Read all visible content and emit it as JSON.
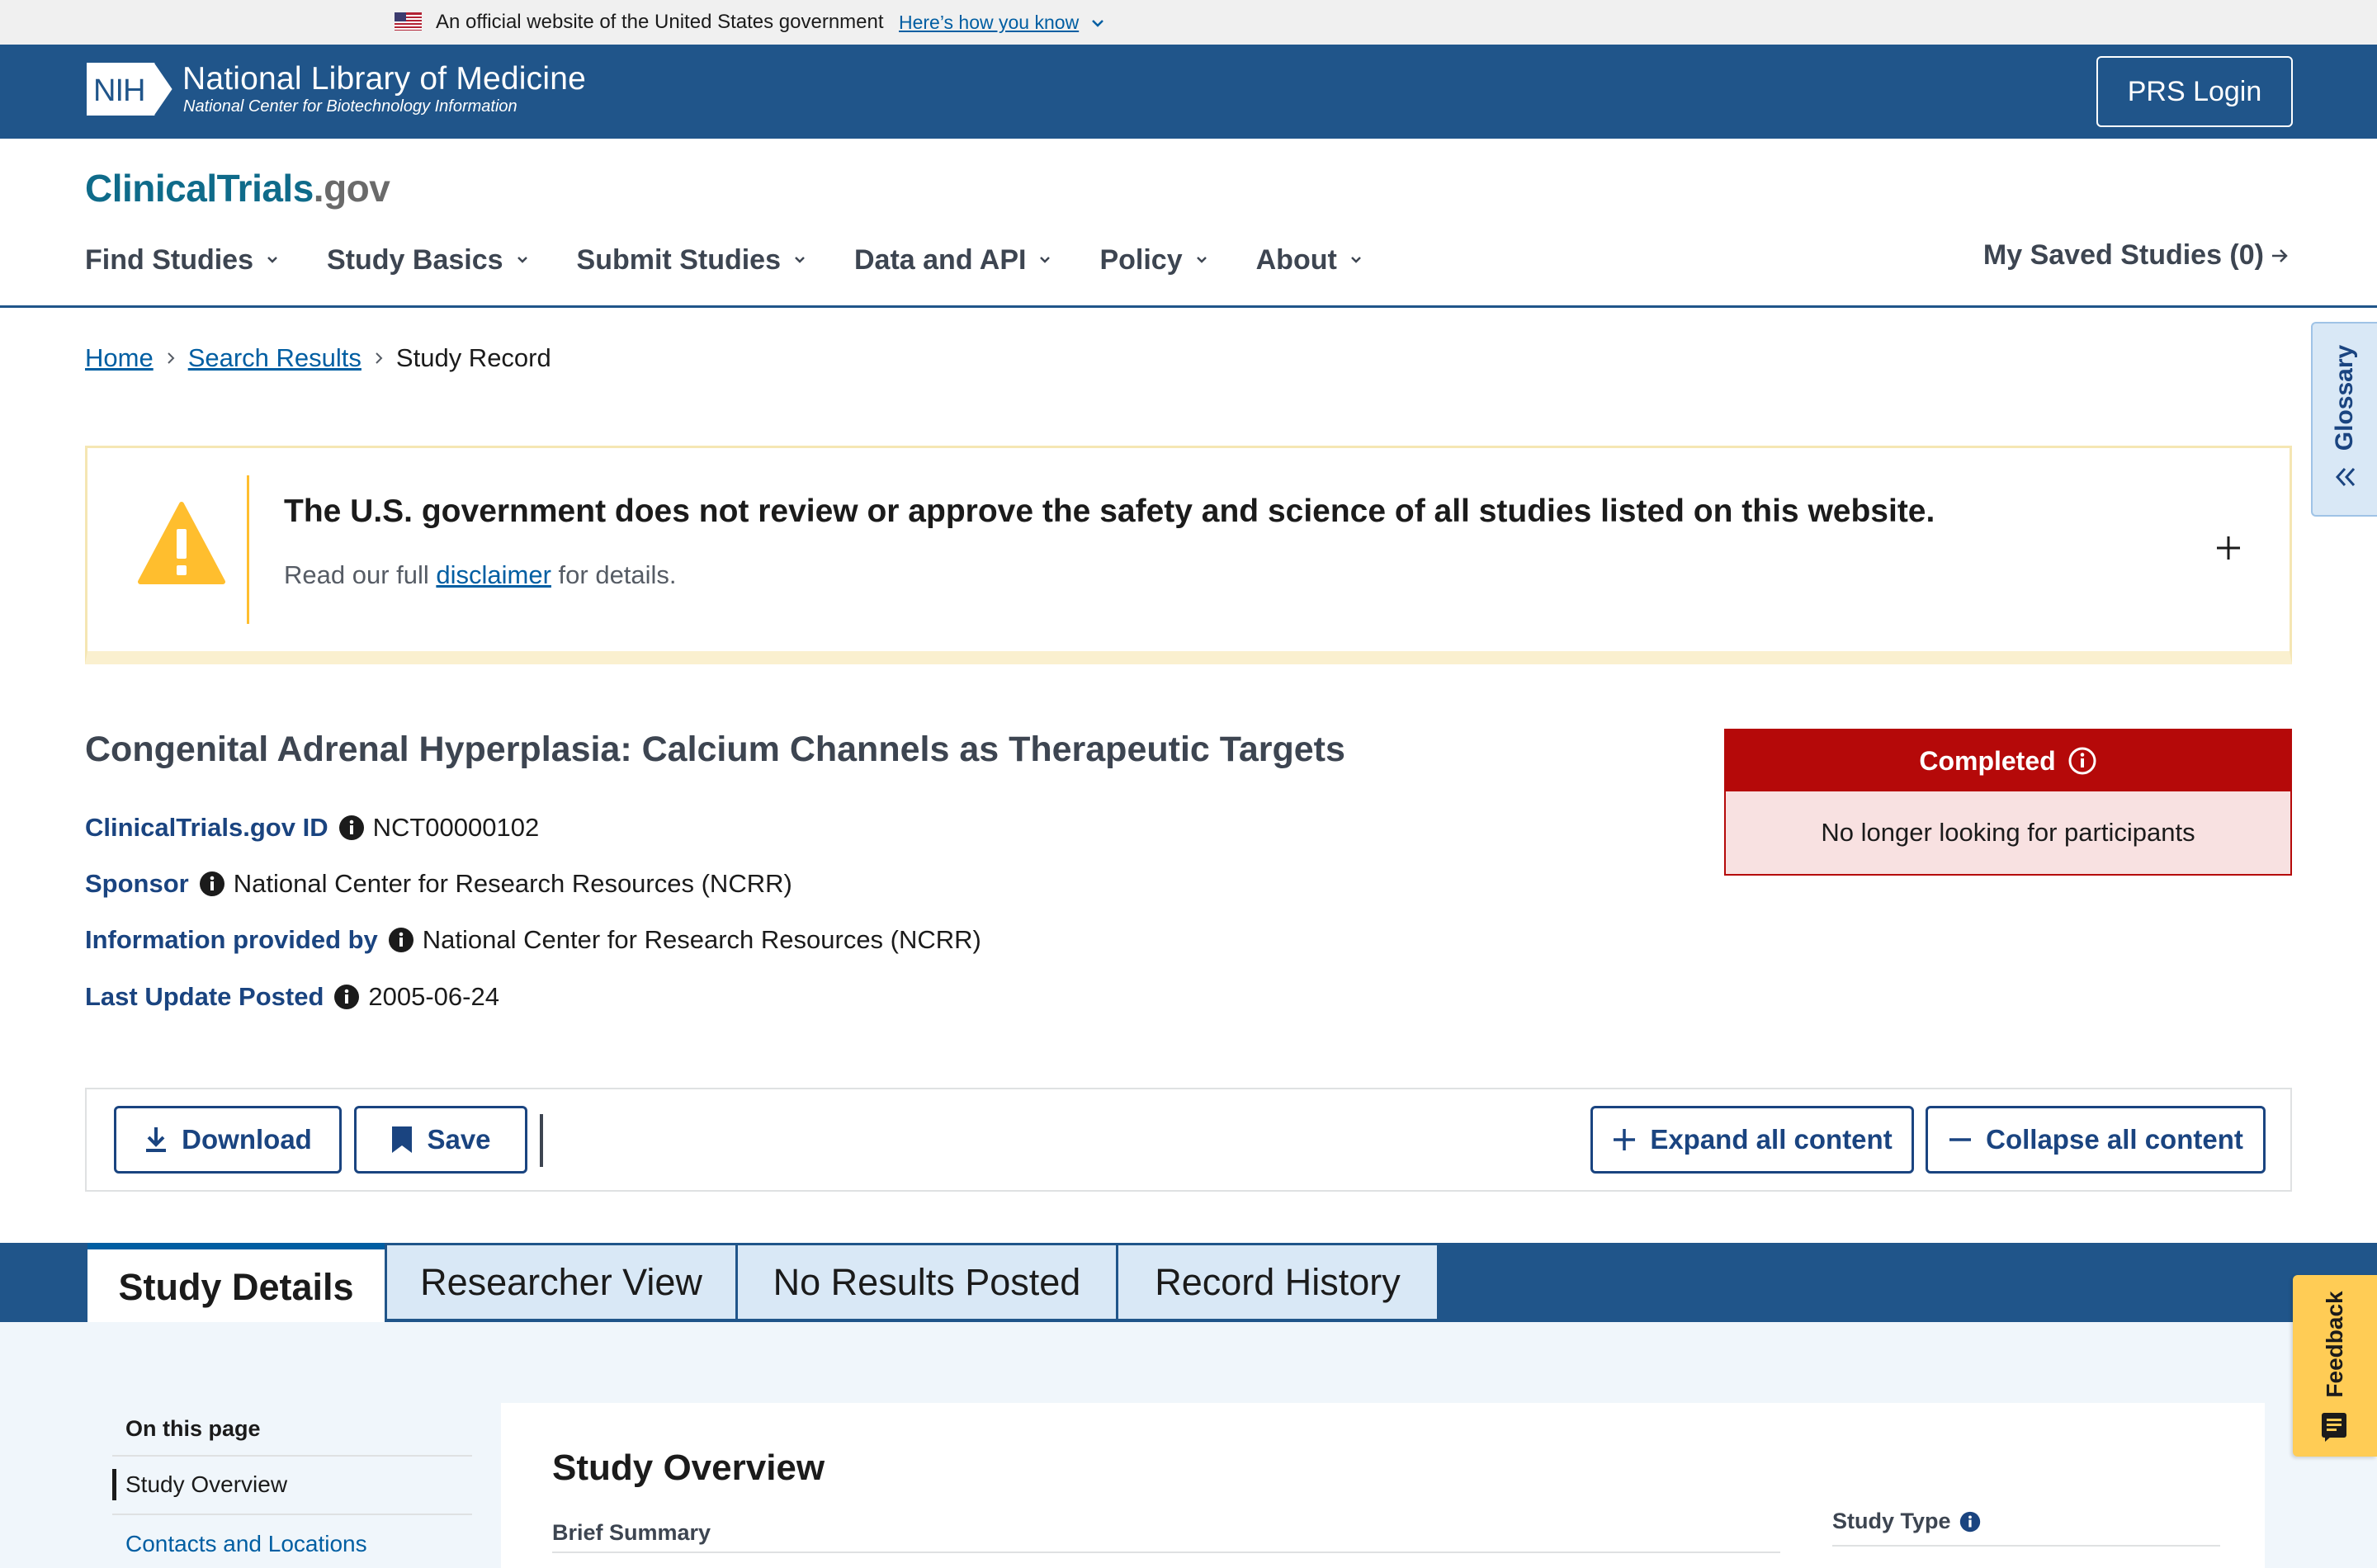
{
  "gov_banner": {
    "official_text": "An official website of the United States government",
    "how_you_know": "Here’s how you know"
  },
  "nlm_header": {
    "logo_text": "NIH",
    "title": "National Library of Medicine",
    "subtitle": "National Center for Biotechnology Information",
    "login_label": "PRS Login"
  },
  "site": {
    "logo_main": "ClinicalTrials",
    "logo_suffix": ".gov",
    "nav": [
      {
        "label": "Find Studies"
      },
      {
        "label": "Study Basics"
      },
      {
        "label": "Submit Studies"
      },
      {
        "label": "Data and API"
      },
      {
        "label": "Policy"
      },
      {
        "label": "About"
      }
    ],
    "saved_studies": "My Saved Studies (0)",
    "glossary": "Glossary"
  },
  "breadcrumb": {
    "home": "Home",
    "search_results": "Search Results",
    "current": "Study Record"
  },
  "disclaimer": {
    "title": "The U.S. government does not review or approve the safety and science of all studies listed on this website.",
    "text_before": "Read our full ",
    "link": "disclaimer",
    "text_after": " for details."
  },
  "study": {
    "title": "Congenital Adrenal Hyperplasia: Calcium Channels as Therapeutic Targets",
    "meta": [
      {
        "label": "ClinicalTrials.gov ID",
        "value": "NCT00000102"
      },
      {
        "label": "Sponsor",
        "value": "National Center for Research Resources (NCRR)"
      },
      {
        "label": "Information provided by",
        "value": "National Center for Research Resources (NCRR)"
      },
      {
        "label": "Last Update Posted",
        "value": "2005-06-24"
      }
    ],
    "status": {
      "label": "Completed",
      "description": "No longer looking for participants",
      "color": "#b50909"
    }
  },
  "actions": {
    "download": "Download",
    "save": "Save",
    "expand": "Expand all content",
    "collapse": "Collapse all content"
  },
  "tabs": [
    {
      "label": "Study Details",
      "active": true
    },
    {
      "label": "Researcher View",
      "active": false
    },
    {
      "label": "No Results Posted",
      "active": false
    },
    {
      "label": "Record History",
      "active": false
    }
  ],
  "sidebar": {
    "heading": "On this page",
    "items": [
      {
        "label": "Study Overview"
      },
      {
        "label": "Contacts and Locations"
      }
    ]
  },
  "content": {
    "section_title": "Study Overview",
    "brief_summary_label": "Brief Summary",
    "study_type_label": "Study Type"
  },
  "feedback": {
    "label": "Feedback"
  },
  "colors": {
    "primary": "#20558a",
    "link": "#005ea2",
    "warning": "#ffbe2e",
    "feedback": "#ffcc55"
  }
}
